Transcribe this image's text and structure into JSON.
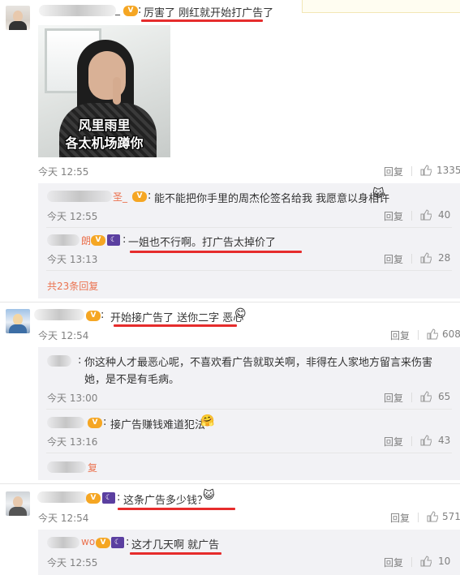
{
  "comments": [
    {
      "text": "厉害了 刚红就开始打广告了",
      "time": "今天 12:55",
      "reply": "回复",
      "likes": "1335",
      "photo_caption_line1": "风里雨里",
      "photo_caption_line2": "各太机场蹲你",
      "replies": [
        {
          "text": "能不能把你手里的周杰伦签名给我 我愿意以身相许",
          "time": "今天 12:55",
          "reply": "回复",
          "likes": "40"
        },
        {
          "text": "一姐也不行啊。打广告太掉价了",
          "time": "今天 13:13",
          "reply": "回复",
          "likes": "28"
        }
      ],
      "more": "共23条回复"
    },
    {
      "text": "开始接广告了 送你二字 恶心",
      "time": "今天 12:54",
      "reply": "回复",
      "likes": "608",
      "replies": [
        {
          "text": "你这种人才最恶心呢，不喜欢看广告就取关啊，非得在人家地方留言来伤害她，是不是有毛病。",
          "time": "今天 13:00",
          "reply": "回复",
          "likes": "65"
        },
        {
          "text": "接广告赚钱难道犯法",
          "time": "今天 13:16",
          "reply": "回复",
          "likes": "43"
        }
      ],
      "more": "复"
    },
    {
      "text": "这条广告多少钱？",
      "time": "今天 12:54",
      "reply": "回复",
      "likes": "571",
      "replies": [
        {
          "text": "这才几天啊 就广告",
          "time": "今天 12:55",
          "reply": "回复",
          "likes": "10"
        }
      ]
    }
  ],
  "fragments": {
    "name_suffix_1": "_",
    "name_suffix_2": "圣_",
    "name_suffix_3": "朗",
    "name_suffix_4": "wo"
  },
  "colors": {
    "accent_red": "#e62c2c",
    "link": "#eb7350",
    "reply_bg": "#f2f2f5",
    "meta_gray": "#808080"
  },
  "icons": [
    "vip-badge-icon",
    "moon-badge-icon",
    "thumbs-up-icon",
    "cat-emoji-icon",
    "smile-emoji-icon",
    "hug-emoji-icon"
  ]
}
